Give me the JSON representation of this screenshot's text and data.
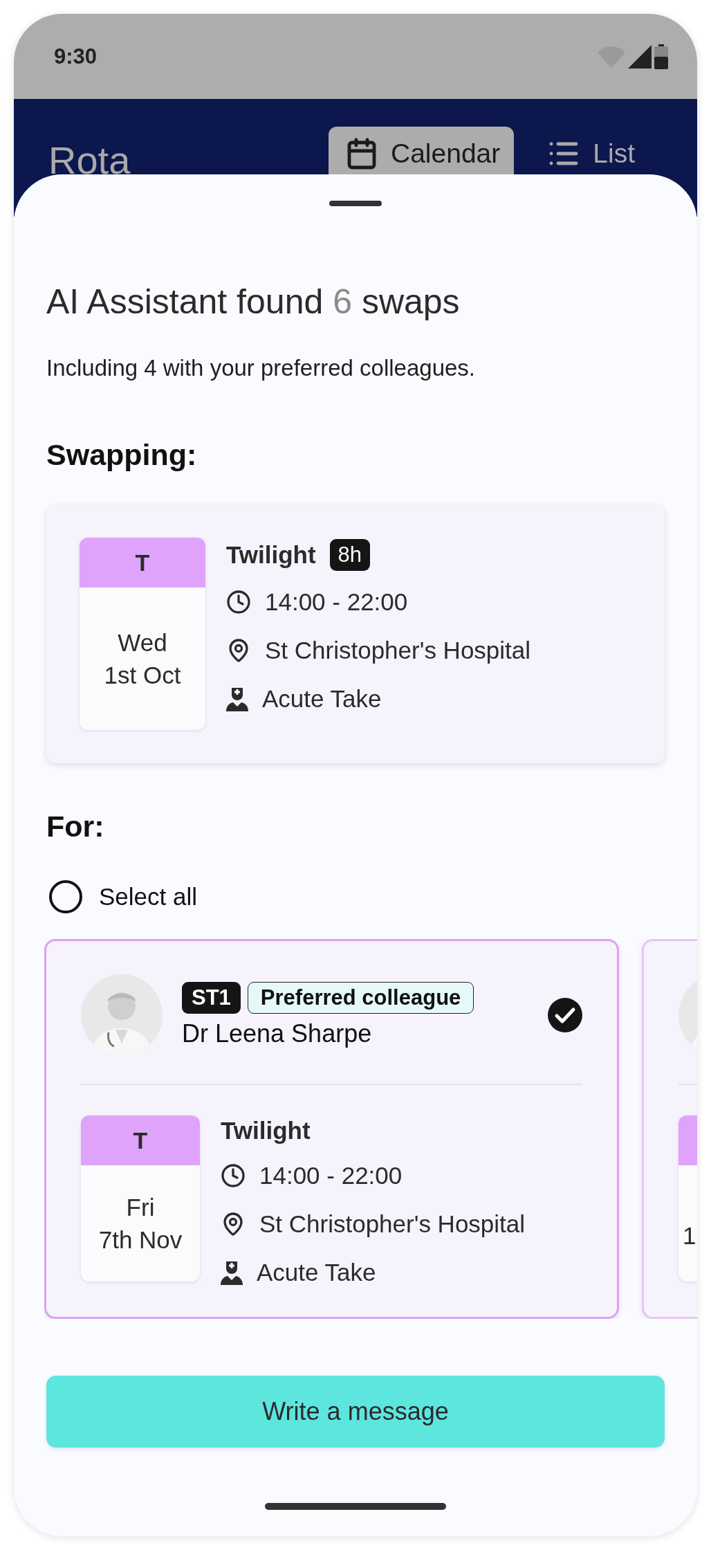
{
  "status_bar": {
    "time": "9:30"
  },
  "header": {
    "title": "Rota",
    "tabs": [
      {
        "label": "Calendar",
        "selected": true
      },
      {
        "label": "List",
        "selected": false
      }
    ]
  },
  "sheet": {
    "title_before": "AI Assistant found",
    "count": "6",
    "title_after": "swaps",
    "subtitle": "Including 4 with your preferred colleagues.",
    "swapping_label": "Swapping:",
    "swapping": {
      "code": "T",
      "day": "Wed",
      "date": "1st Oct",
      "name": "Twilight",
      "hours": "8h",
      "time": "14:00 - 22:00",
      "location": "St Christopher's Hospital",
      "role": "Acute Take"
    },
    "for_label": "For:",
    "select_all": {
      "label": "Select all",
      "checked": false
    },
    "colleagues": [
      {
        "kind": "full",
        "grade": "ST1",
        "tag": "Preferred colleague",
        "name": "Dr Leena Sharpe",
        "selected": true,
        "shift": {
          "code": "T",
          "day": "Fri",
          "date": "7th Nov",
          "name": "Twilight",
          "time": "14:00 - 22:00",
          "location": "St Christopher's Hospital",
          "role": "Acute Take"
        }
      },
      {
        "kind": "peek",
        "date_fragment": "1"
      }
    ],
    "button": "Write a message"
  }
}
